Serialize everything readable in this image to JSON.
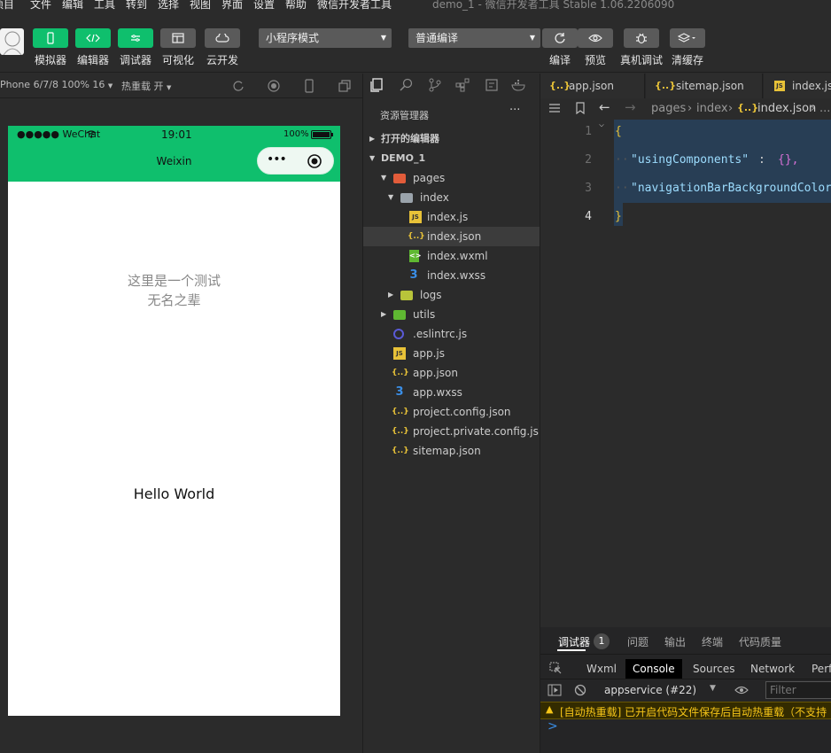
{
  "menu": {
    "items": [
      "项目",
      "文件",
      "编辑",
      "工具",
      "转到",
      "选择",
      "视图",
      "界面",
      "设置",
      "帮助",
      "微信开发者工具"
    ],
    "window_title": "demo_1 - 微信开发者工具 Stable 1.06.2206090"
  },
  "toolbar": {
    "buttons": [
      {
        "label": "模拟器",
        "icon": "phone-icon"
      },
      {
        "label": "编辑器",
        "icon": "code-icon"
      },
      {
        "label": "调试器",
        "icon": "debug-icon"
      },
      {
        "label": "可视化",
        "icon": "layout-icon"
      },
      {
        "label": "云开发",
        "icon": "cloud-icon"
      }
    ],
    "mode_select": "小程序模式",
    "compile_select": "普通编译",
    "right_buttons": [
      {
        "label": "编译",
        "icon": "refresh-icon"
      },
      {
        "label": "预览",
        "icon": "eye-icon"
      },
      {
        "label": "真机调试",
        "icon": "bug-icon"
      },
      {
        "label": "清缓存",
        "icon": "layers-icon"
      }
    ]
  },
  "simulator": {
    "device": "Phone 6/7/8 100% 16",
    "hot_reload": "热重载 开",
    "status": {
      "carrier": "●●●●● WeChat",
      "time": "19:01",
      "battery": "100%"
    },
    "nav_title": "Weixin",
    "page_text_line1": "这里是一个测试",
    "page_text_line2": "无名之辈",
    "hello": "Hello World",
    "colors": {
      "nav": "#0fbf6d"
    }
  },
  "explorer": {
    "title": "资源管理器",
    "more": "···",
    "open_editors": "打开的编辑器",
    "project": "DEMO_1",
    "tree": [
      {
        "label": "pages",
        "icon": "folder-icon"
      },
      {
        "label": "index",
        "icon": "folder-open-icon"
      },
      {
        "label": "index.js",
        "icon": "js-file-icon"
      },
      {
        "label": "index.json",
        "icon": "json-file-icon"
      },
      {
        "label": "index.wxml",
        "icon": "wxml-file-icon"
      },
      {
        "label": "index.wxss",
        "icon": "wxss-file-icon"
      },
      {
        "label": "logs",
        "icon": "folder-icon"
      },
      {
        "label": "utils",
        "icon": "folder-icon"
      },
      {
        "label": ".eslintrc.js",
        "icon": "eslint-file-icon"
      },
      {
        "label": "app.js",
        "icon": "js-file-icon"
      },
      {
        "label": "app.json",
        "icon": "json-file-icon"
      },
      {
        "label": "app.wxss",
        "icon": "wxss-file-icon"
      },
      {
        "label": "project.config.json",
        "icon": "json-file-icon"
      },
      {
        "label": "project.private.config.js...",
        "icon": "json-file-icon"
      },
      {
        "label": "sitemap.json",
        "icon": "json-file-icon"
      }
    ]
  },
  "editor": {
    "tabs": [
      "app.json",
      "sitemap.json",
      "index.js"
    ],
    "tab_icons": [
      "{..}",
      "{..}",
      "JS"
    ],
    "breadcrumbs": [
      "pages",
      "index",
      "index.json",
      "..."
    ],
    "line_numbers": [
      "1",
      "2",
      "3",
      "4"
    ],
    "lines": [
      {
        "a": "{",
        "b": "",
        "c": ""
      },
      {
        "a": "\"usingComponents\"",
        "b": ": ",
        "c": "{},"
      },
      {
        "a": "\"navigationBarBackgroundColor\"",
        "b": "",
        "c": ""
      },
      {
        "a": "}",
        "b": "",
        "c": ""
      }
    ]
  },
  "debugger": {
    "tabs": [
      "调试器",
      "问题",
      "输出",
      "终端",
      "代码质量"
    ],
    "badge": "1",
    "panels": [
      "Wxml",
      "Console",
      "Sources",
      "Network",
      "Perf"
    ],
    "context": "appservice (#22)",
    "filter_placeholder": "Filter",
    "warning": "[自动热重载] 已开启代码文件保存后自动热重载（不支持",
    "prompt": ">"
  }
}
